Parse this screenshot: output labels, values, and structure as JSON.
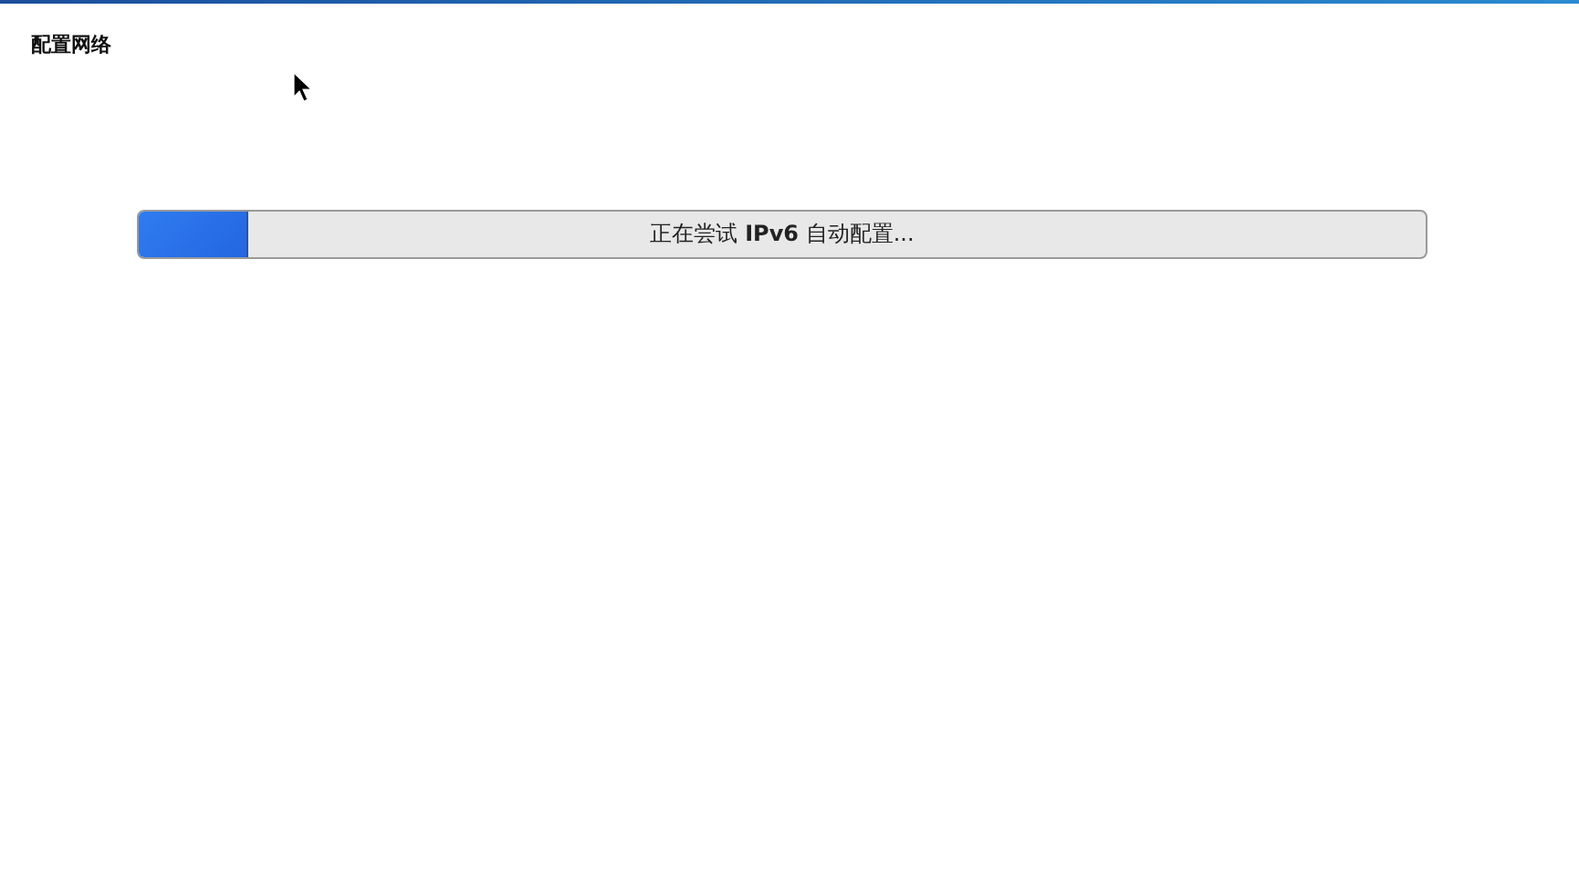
{
  "window": {
    "title": "配置网络"
  },
  "progress": {
    "label": "正在尝试 **IPv6** 自动配置...",
    "level": 0.084
  }
}
